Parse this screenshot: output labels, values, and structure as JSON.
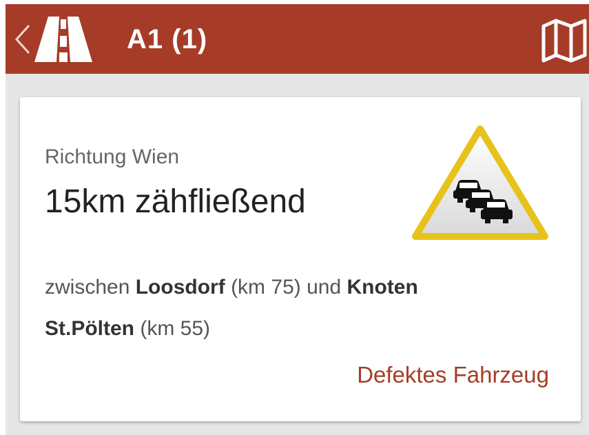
{
  "header": {
    "title": "A1 (1)",
    "back_icon": "chevron-left-icon",
    "logo_icon": "highway-road-icon",
    "map_icon": "map-icon",
    "bg_color": "#a63c28"
  },
  "card": {
    "direction": "Richtung Wien",
    "headline": "15km zähfließend",
    "sign_icon": "traffic-jam-warning-sign-icon",
    "detail": {
      "prefix": "zwischen",
      "from_name": "Loosdorf",
      "from_km": "(km 75)",
      "connector": "und",
      "to_name": "Knoten St.Pölten",
      "to_km": "(km 55)"
    },
    "reason": "Defektes Fahrzeug",
    "accent_color": "#a63c28",
    "sign_color": "#e7c21b"
  }
}
